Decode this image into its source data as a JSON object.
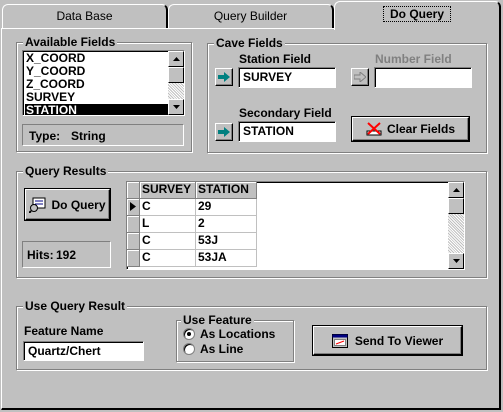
{
  "tabs": [
    {
      "label": "Data Base"
    },
    {
      "label": "Query Builder"
    },
    {
      "label": "Do Query"
    }
  ],
  "available_fields": {
    "title": "Available Fields",
    "items": [
      "X_COORD",
      "Y_COORD",
      "Z_COORD",
      "SURVEY",
      "STATION"
    ],
    "selected": "STATION",
    "type_label": "Type:",
    "type_value": "String"
  },
  "cave_fields": {
    "title": "Cave Fields",
    "station_field_label": "Station Field",
    "station_field_value": "SURVEY",
    "number_field_label": "Number Field",
    "number_field_value": "",
    "secondary_field_label": "Secondary Field",
    "secondary_field_value": "STATION",
    "clear_fields_label": "Clear Fields"
  },
  "query_results": {
    "title": "Query Results",
    "do_query_label": "Do Query",
    "hits_label": "Hits:",
    "hits_value": "192",
    "columns": [
      "SURVEY",
      "STATION"
    ],
    "rows": [
      [
        "C",
        "29"
      ],
      [
        "L",
        "2"
      ],
      [
        "C",
        "53J"
      ],
      [
        "C",
        "53JA"
      ]
    ]
  },
  "use_query_result": {
    "title": "Use Query Result",
    "feature_name_label": "Feature Name",
    "feature_name_value": "Quartz/Chert",
    "use_feature_title": "Use Feature",
    "options": [
      "As Locations",
      "As Line"
    ],
    "selected_option": "As Locations",
    "send_to_viewer_label": "Send To Viewer"
  },
  "colors": {
    "background": "#c0c0c0",
    "arrow_teal": "#008080",
    "clear_red": "#ff0000"
  }
}
